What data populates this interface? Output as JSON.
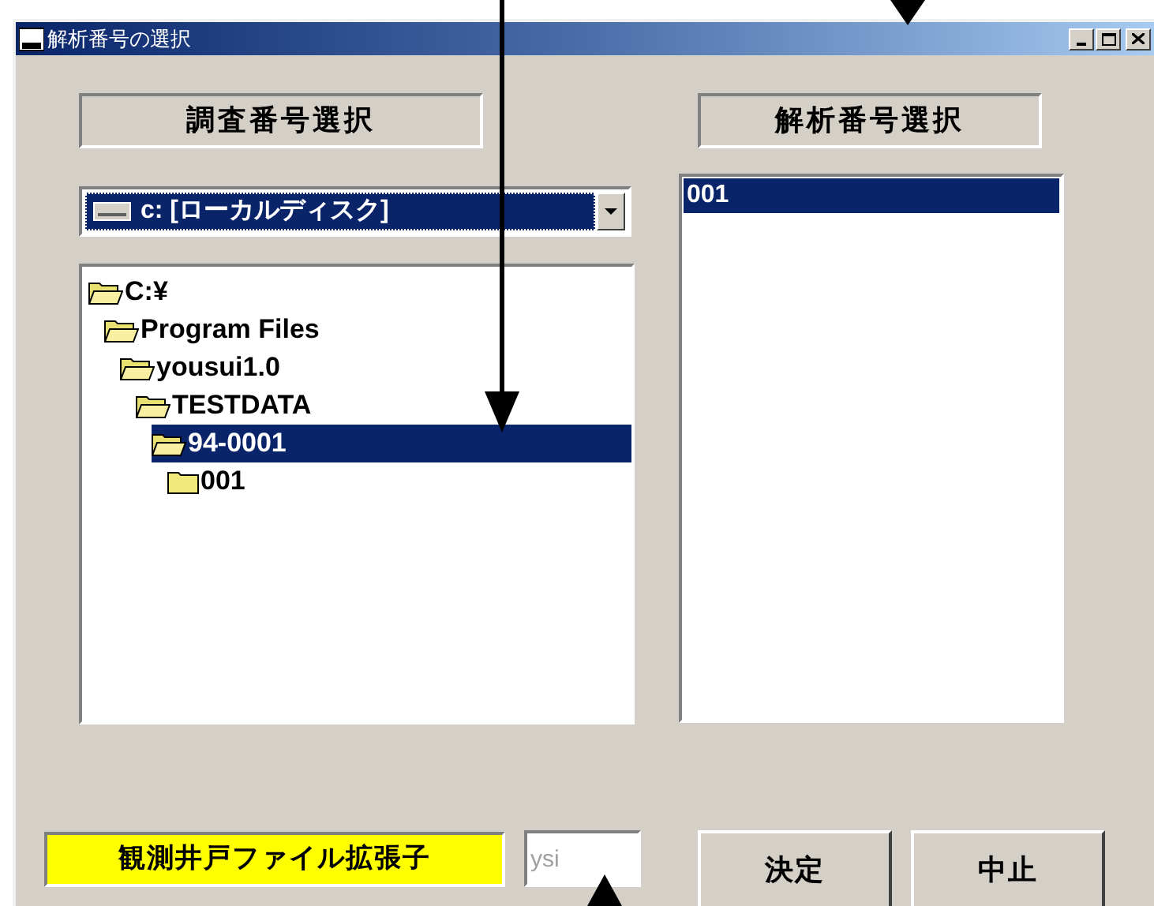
{
  "window": {
    "title": "解析番号の選択"
  },
  "left_header": "調査番号選択",
  "right_header": "解析番号選択",
  "drive_combo": {
    "value": "c: [ローカルディスク]"
  },
  "tree": [
    {
      "label": "C:¥",
      "expanded": true,
      "selected": false,
      "children": [
        {
          "label": "Program Files",
          "expanded": true,
          "selected": false,
          "children": [
            {
              "label": "yousui1.0",
              "expanded": true,
              "selected": false,
              "children": [
                {
                  "label": "TESTDATA",
                  "expanded": true,
                  "selected": false,
                  "children": [
                    {
                      "label": "94-0001",
                      "expanded": true,
                      "selected": true,
                      "children": [
                        {
                          "label": "001",
                          "expanded": false,
                          "selected": false
                        }
                      ]
                    }
                  ]
                }
              ]
            }
          ]
        }
      ]
    }
  ],
  "analysis_list": [
    {
      "label": "001",
      "selected": true
    }
  ],
  "extension_label": "観測井戸ファイル拡張子",
  "extension_field": {
    "value": "ysi",
    "disabled": true
  },
  "buttons": [
    "決定",
    "中止"
  ]
}
